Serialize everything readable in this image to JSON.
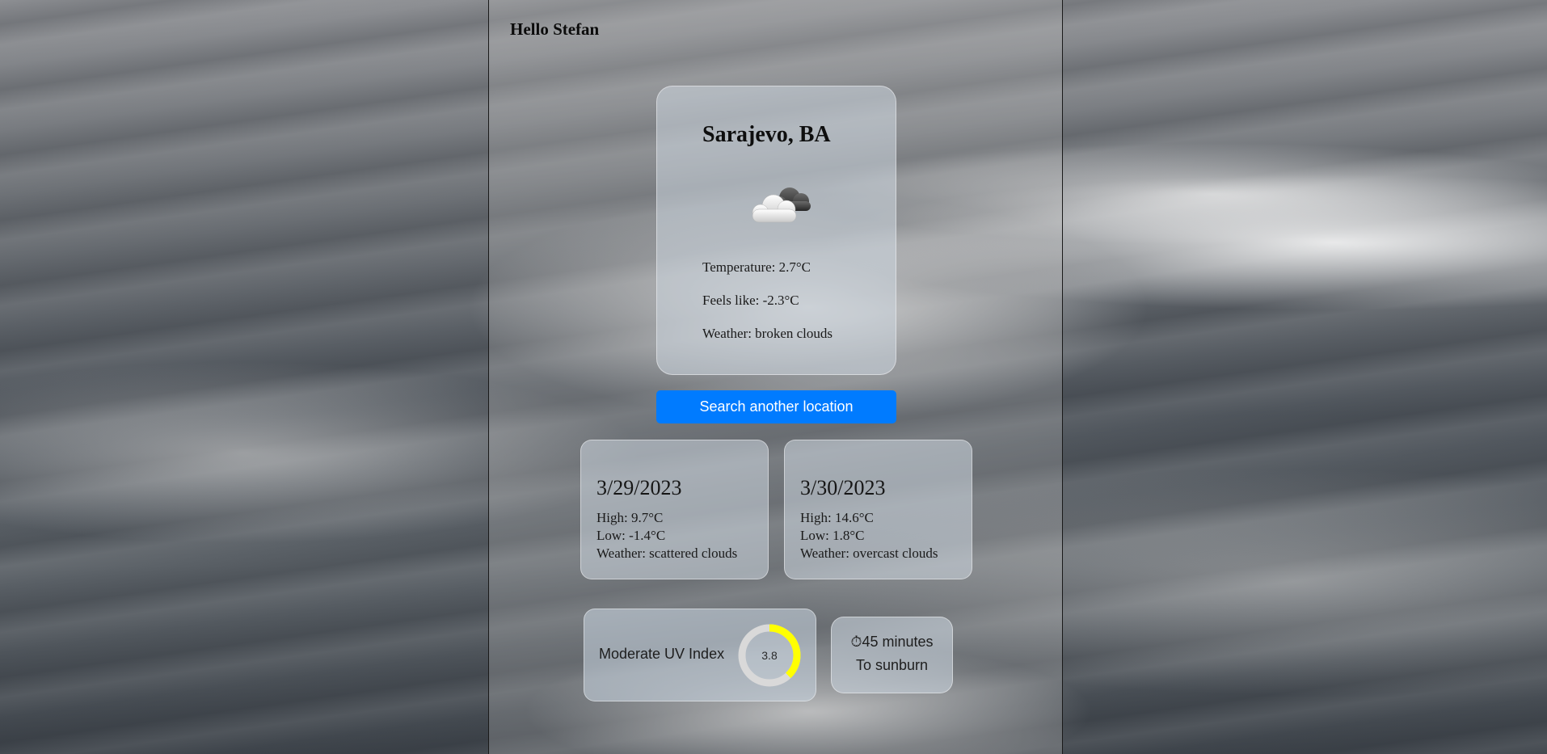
{
  "greeting": "Hello Stefan",
  "current": {
    "location": "Sarajevo, BA",
    "icon": "broken-clouds-icon",
    "temperature": "Temperature: 2.7°C",
    "feels_like": "Feels like: -2.3°C",
    "weather": "Weather: broken clouds"
  },
  "search_button_label": "Search another location",
  "forecast": [
    {
      "date": "3/29/2023",
      "high": "High: 9.7°C",
      "low": "Low: -1.4°C",
      "weather": "Weather: scattered clouds"
    },
    {
      "date": "3/30/2023",
      "high": "High: 14.6°C",
      "low": "Low: 1.8°C",
      "weather": "Weather: overcast clouds"
    }
  ],
  "uv": {
    "label": "Moderate UV Index",
    "value": "3.8",
    "ring_fill_fraction": 0.38,
    "ring_color": "#ffff00",
    "ring_track_color": "#d9d9d9"
  },
  "sunburn": {
    "icon": "stopwatch-icon",
    "time": "⏱45 minutes",
    "caption": "To sunburn"
  },
  "colors": {
    "button": "#007bff",
    "button_text": "#ffffff"
  }
}
